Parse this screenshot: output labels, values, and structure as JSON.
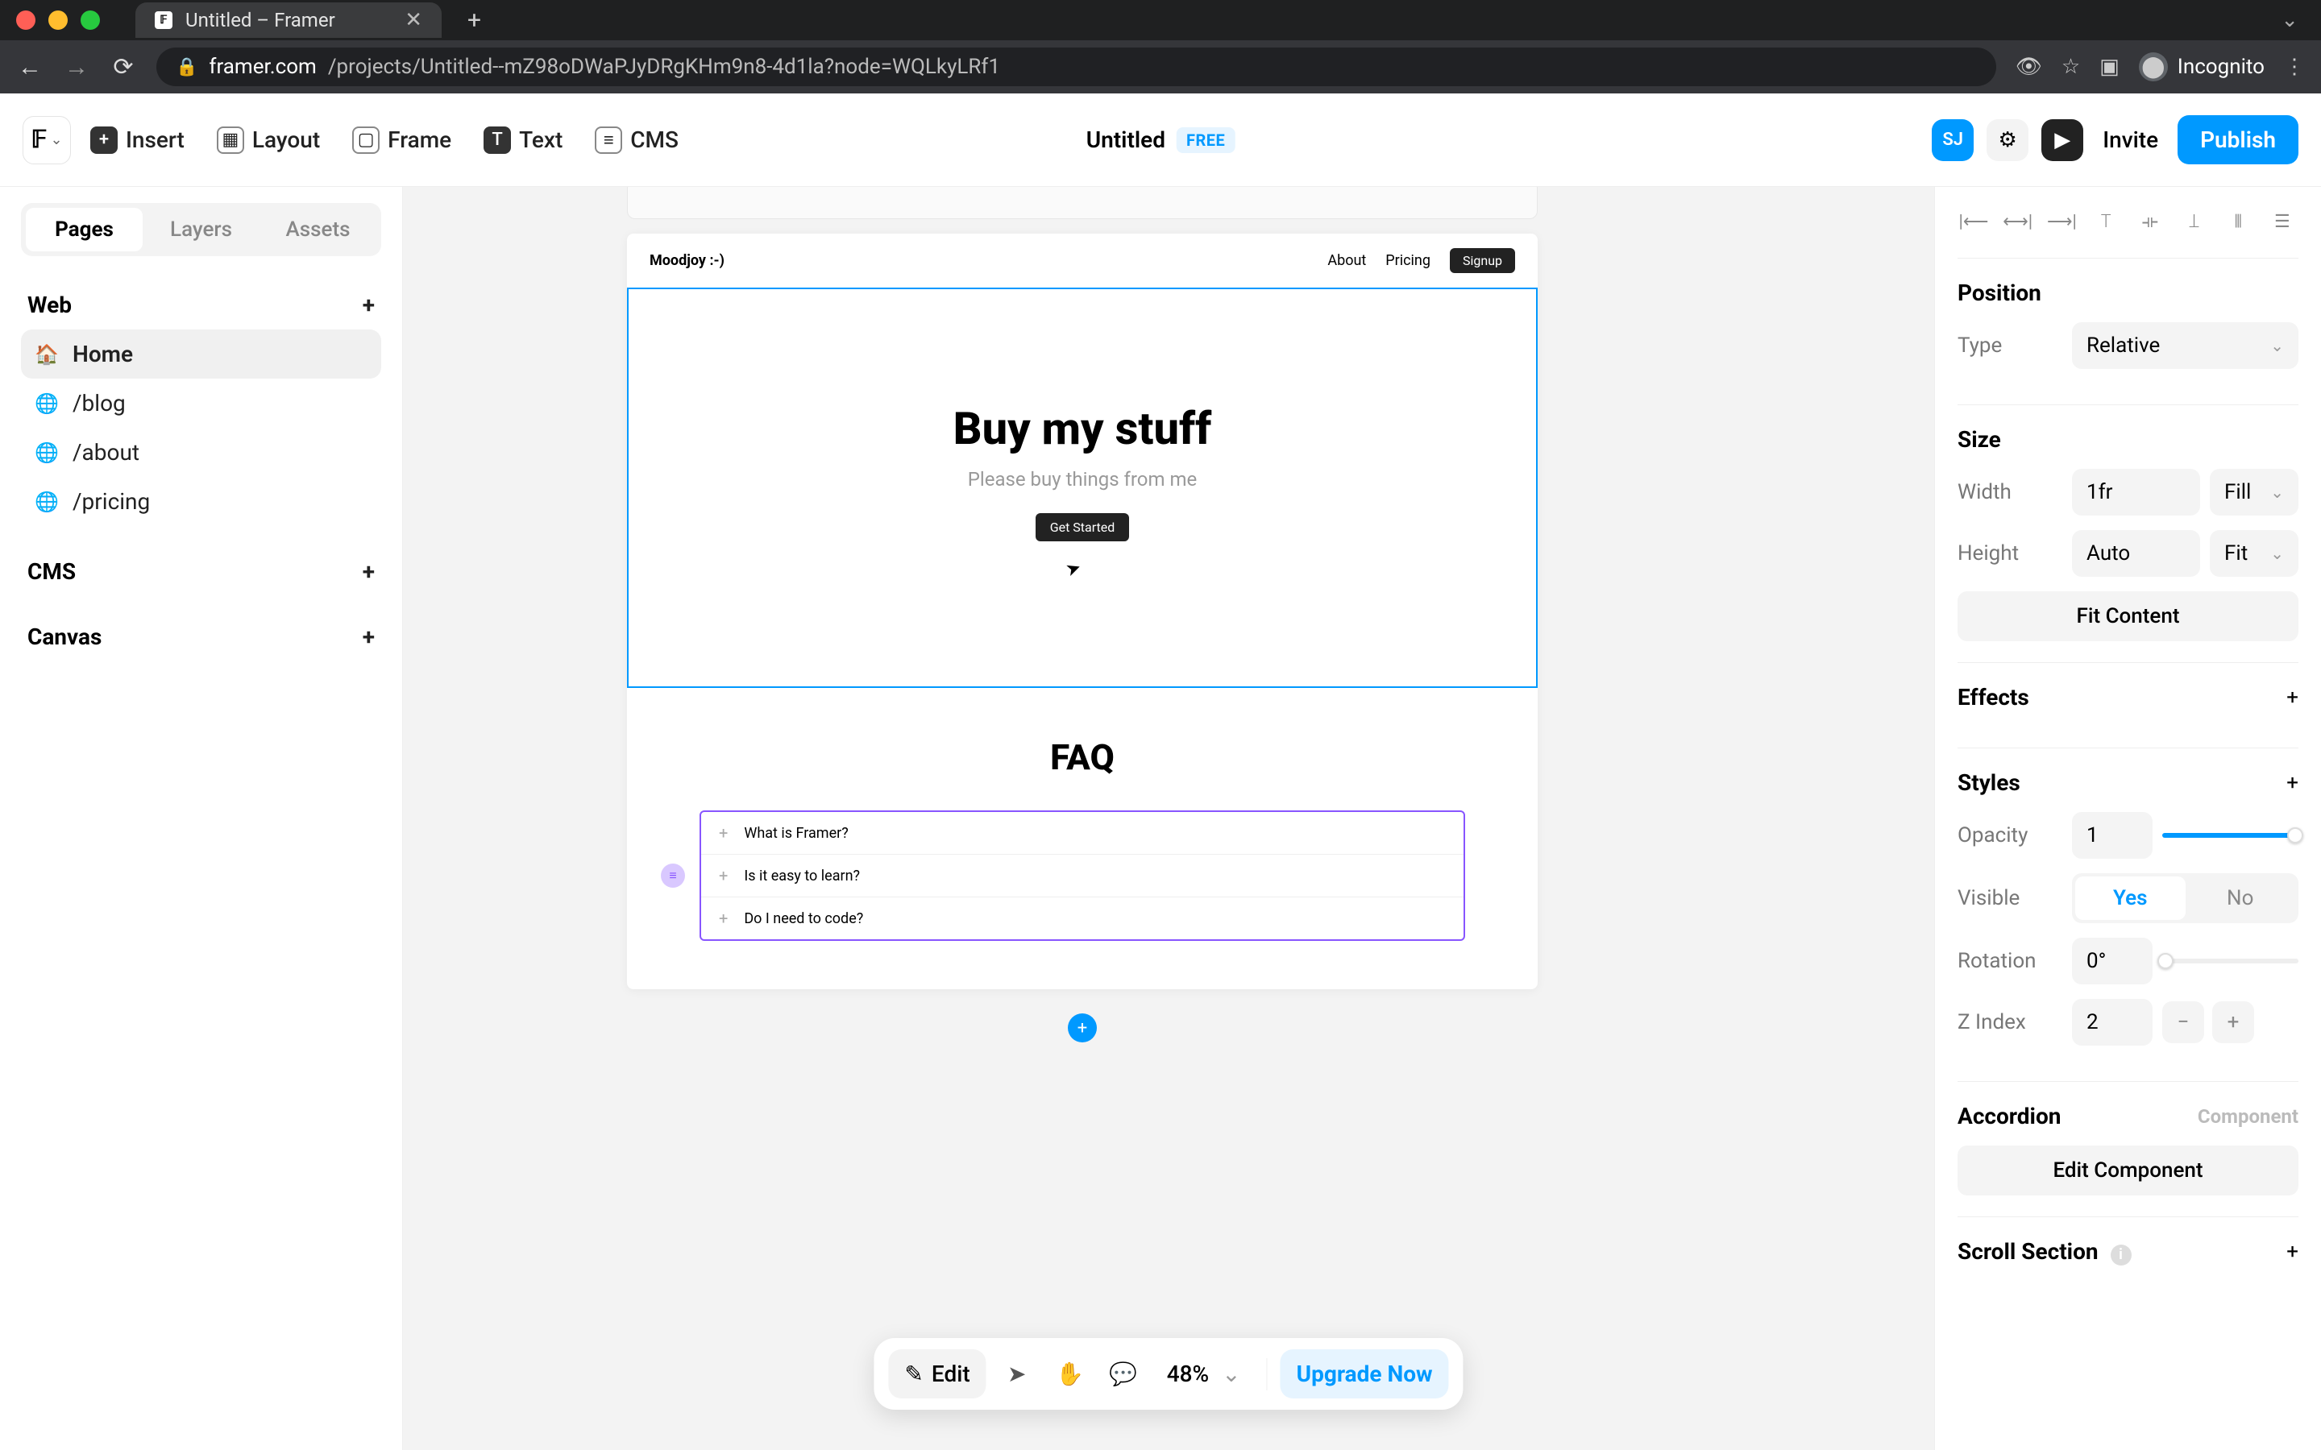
{
  "browser": {
    "tab_title": "Untitled – Framer",
    "url_domain": "framer.com",
    "url_path": "/projects/Untitled--mZ98oDWaPJyDRgKHm9n8-4d1la?node=WQLkyLRf1",
    "incognito_label": "Incognito"
  },
  "toolbar": {
    "insert": "Insert",
    "layout": "Layout",
    "frame": "Frame",
    "text": "Text",
    "cms": "CMS",
    "doc_title": "Untitled",
    "free_badge": "FREE",
    "avatar_initials": "SJ",
    "invite": "Invite",
    "publish": "Publish"
  },
  "left": {
    "tabs": {
      "pages": "Pages",
      "layers": "Layers",
      "assets": "Assets"
    },
    "sections": {
      "web": "Web",
      "cms": "CMS",
      "canvas": "Canvas"
    },
    "pages": [
      {
        "label": "Home",
        "icon": "home",
        "active": true
      },
      {
        "label": "/blog",
        "icon": "globe",
        "active": false
      },
      {
        "label": "/about",
        "icon": "globe",
        "active": false
      },
      {
        "label": "/pricing",
        "icon": "globe",
        "active": false
      }
    ]
  },
  "canvas": {
    "site": {
      "brand": "Moodjoy :-)",
      "nav": {
        "about": "About",
        "pricing": "Pricing",
        "signup": "Signup"
      },
      "hero": {
        "title": "Buy my stuff",
        "subtitle": "Please buy things from me",
        "cta": "Get Started"
      },
      "faq": {
        "title": "FAQ",
        "items": [
          "What is Framer?",
          "Is it easy to learn?",
          "Do I need to code?"
        ]
      }
    }
  },
  "floatbar": {
    "edit": "Edit",
    "zoom": "48%",
    "upgrade": "Upgrade Now"
  },
  "inspector": {
    "position": {
      "title": "Position",
      "type_label": "Type",
      "type_value": "Relative"
    },
    "size": {
      "title": "Size",
      "width_label": "Width",
      "width_value": "1fr",
      "width_mode": "Fill",
      "height_label": "Height",
      "height_value": "Auto",
      "height_mode": "Fit",
      "fit_content": "Fit Content"
    },
    "effects": {
      "title": "Effects"
    },
    "styles": {
      "title": "Styles",
      "opacity_label": "Opacity",
      "opacity_value": "1",
      "visible_label": "Visible",
      "yes": "Yes",
      "no": "No",
      "rotation_label": "Rotation",
      "rotation_value": "0°",
      "zindex_label": "Z Index",
      "zindex_value": "2"
    },
    "accordion": {
      "title": "Accordion",
      "component_tag": "Component",
      "edit_btn": "Edit Component"
    },
    "scroll": {
      "title": "Scroll Section"
    }
  }
}
